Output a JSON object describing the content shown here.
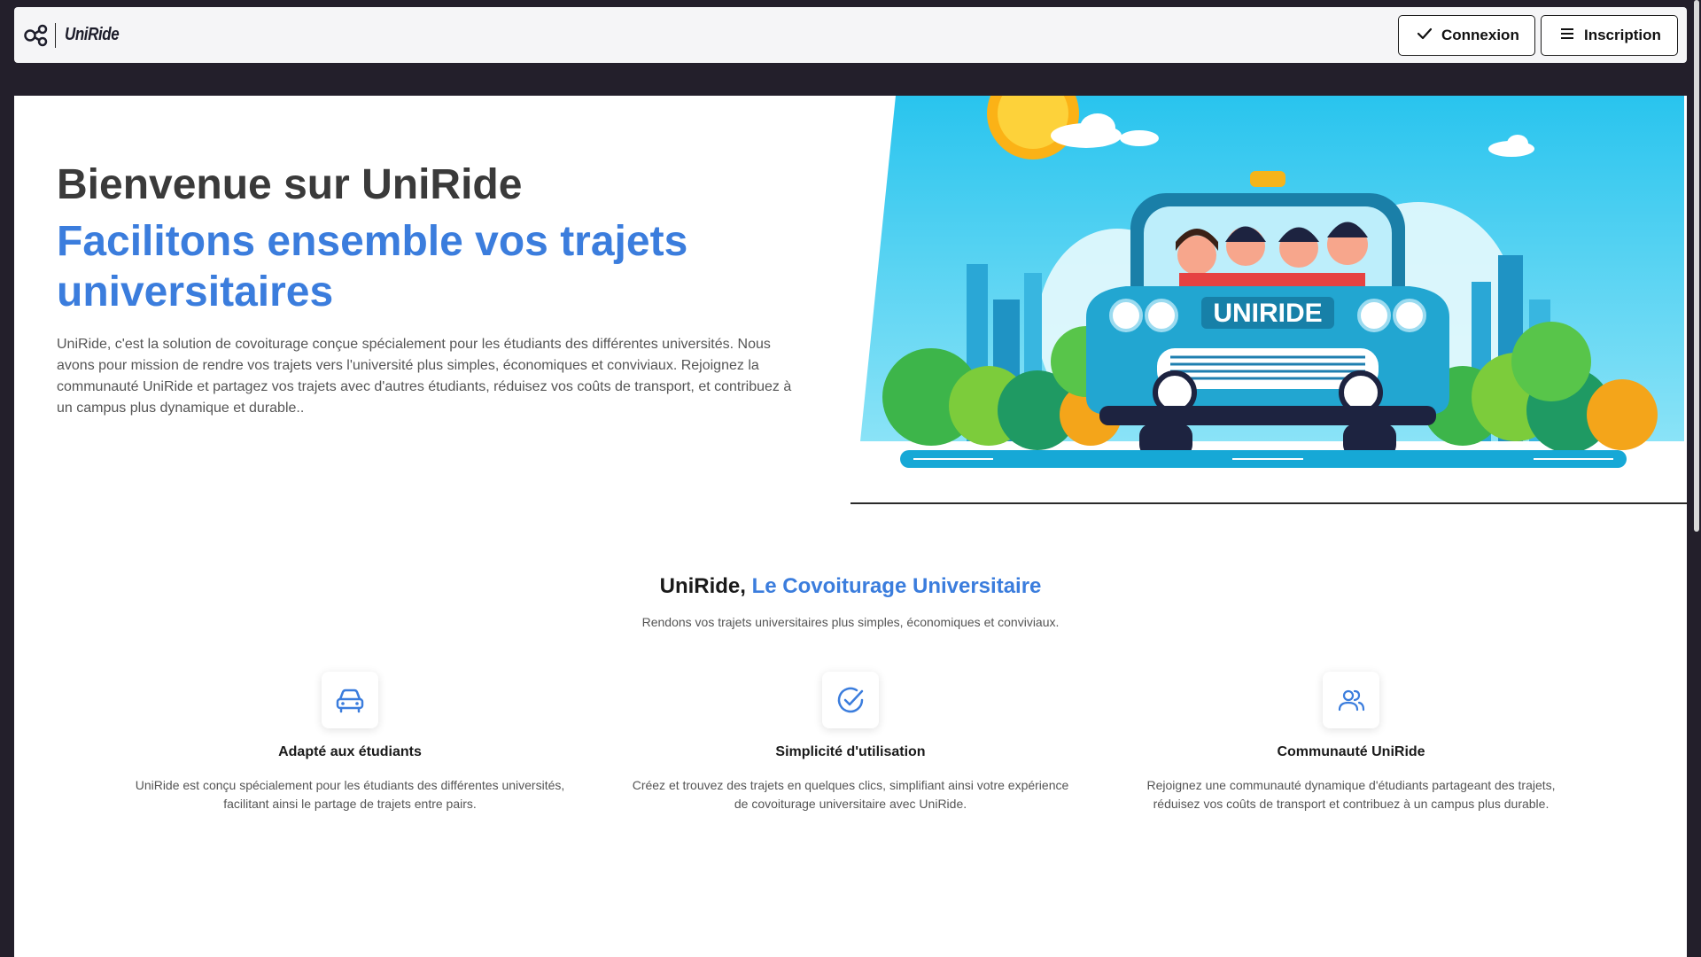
{
  "navbar": {
    "brand": "UniRide",
    "buttons": [
      {
        "label": "Connexion",
        "icon": "check-icon"
      },
      {
        "label": "Inscription",
        "icon": "menu-icon"
      }
    ]
  },
  "hero": {
    "title": "Bienvenue sur UniRide",
    "subtitle": "Facilitons ensemble vos trajets universitaires",
    "description": "UniRide, c'est la solution de covoiturage conçue spécialement pour les étudiants des différentes universités. Nous avons pour mission de rendre vos trajets vers l'université plus simples, économiques et conviviaux. Rejoignez la communauté UniRide et partagez vos trajets avec d'autres étudiants, réduisez vos coûts de transport, et contribuez à un campus plus dynamique et durable..",
    "image_car_text": "UNIRIDE"
  },
  "section": {
    "title_prefix": "UniRide,",
    "title_accent": "Le Covoiturage Universitaire",
    "subtitle": "Rendons vos trajets universitaires plus simples, économiques et conviviaux."
  },
  "features": [
    {
      "icon": "car-icon",
      "title": "Adapté aux étudiants",
      "description": "UniRide est conçu spécialement pour les étudiants des différentes universités, facilitant ainsi le partage de trajets entre pairs."
    },
    {
      "icon": "check-circle-icon",
      "title": "Simplicité d'utilisation",
      "description": "Créez et trouvez des trajets en quelques clics, simplifiant ainsi votre expérience de covoiturage universitaire avec UniRide."
    },
    {
      "icon": "users-icon",
      "title": "Communauté UniRide",
      "description": "Rejoignez une communauté dynamique d'étudiants partageant des trajets, réduisez vos coûts de transport et contribuez à un campus plus durable."
    }
  ],
  "colors": {
    "accent": "#3b7ddd",
    "background": "#231f2b",
    "sky": "#3ec9ef"
  }
}
